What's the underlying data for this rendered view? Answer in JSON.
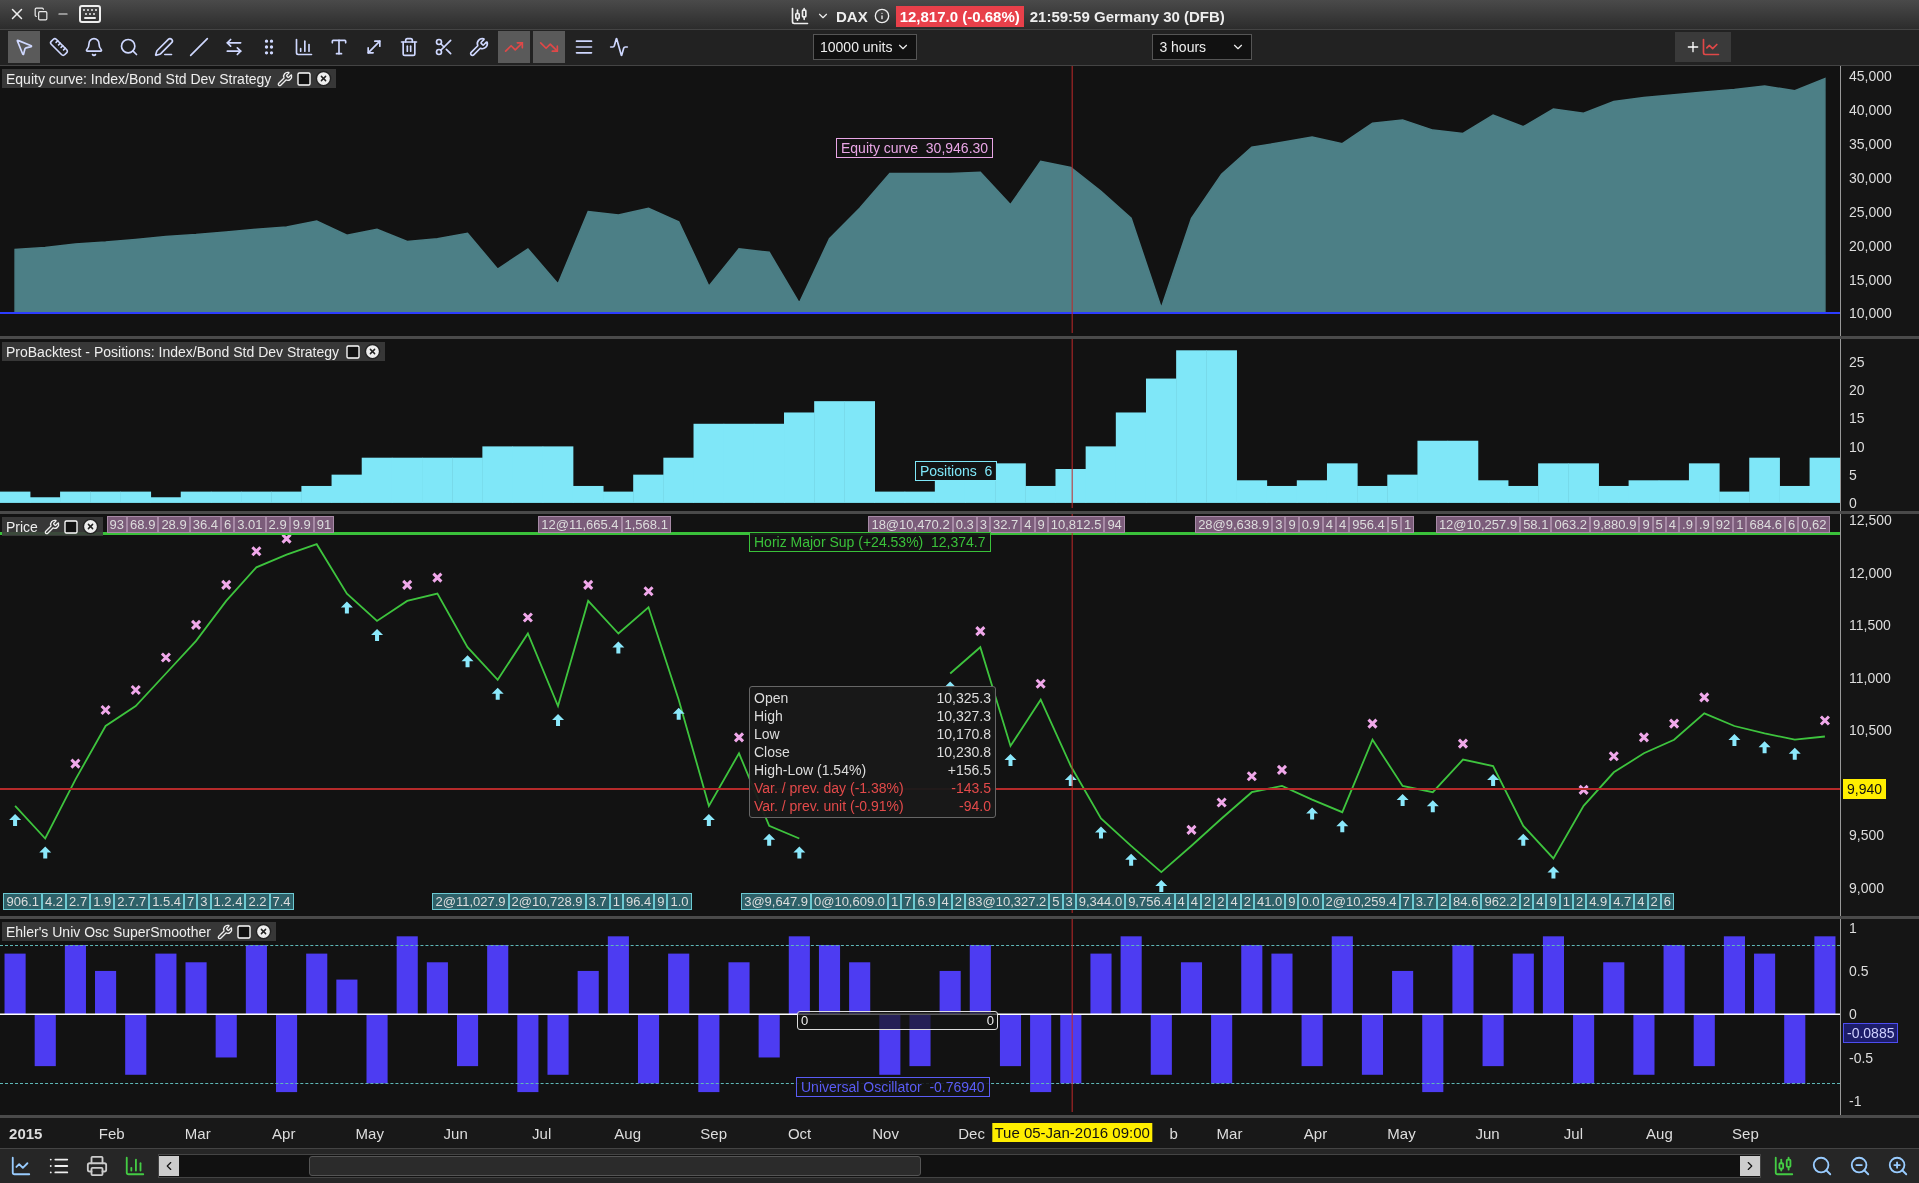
{
  "title_bar": {
    "instrument": "DAX",
    "quote": "12,817.0 (-0.68%)",
    "status": "21:59:59 Germany 30 (DFB)"
  },
  "toolbar": {
    "tools": [
      {
        "selected": true
      },
      {
        "selected": false
      },
      {
        "selected": false
      },
      {
        "selected": false
      },
      {
        "selected": false
      },
      {
        "selected": false
      },
      {
        "selected": false
      },
      {
        "selected": false
      },
      {
        "selected": false
      },
      {
        "selected": false
      },
      {
        "selected": false
      },
      {
        "selected": false
      },
      {
        "selected": false
      },
      {
        "selected": false
      },
      {
        "selected": true
      },
      {
        "selected": true
      },
      {
        "selected": false
      },
      {
        "selected": false
      }
    ],
    "units": "10000 units",
    "timeframe": "3 hours"
  },
  "cursor": {
    "date": "Tue 05-Jan-2016 09:00"
  },
  "equity": {
    "title": "Equity curve: Index/Bond Std Dev Strategy",
    "readout_value": "30,946.30",
    "chart_data": {
      "type": "area",
      "ylim": [
        7100,
        46450
      ],
      "ref_lines": [
        {
          "axis": "y",
          "value": 10000,
          "color": "#2c3cff"
        }
      ],
      "yticks": [
        {
          "value": 45000,
          "label": "45,000"
        },
        {
          "value": 40000,
          "label": "40,000"
        },
        {
          "value": 35000,
          "label": "35,000"
        },
        {
          "value": 30000,
          "label": "30,000"
        },
        {
          "value": 25000,
          "label": "25,000"
        },
        {
          "value": 20000,
          "label": "20,000"
        },
        {
          "value": 15000,
          "label": "15,000"
        },
        {
          "value": 10000,
          "label": "10,000"
        }
      ],
      "series": [
        {
          "name": "Equity curve",
          "color": "#4c7f86",
          "values": [
            19400,
            19700,
            20200,
            20500,
            20900,
            21300,
            21600,
            22000,
            22400,
            22700,
            23600,
            21500,
            22400,
            20600,
            21000,
            21800,
            16500,
            19500,
            14300,
            25000,
            24500,
            25500,
            23500,
            14000,
            19500,
            19000,
            11500,
            21000,
            25500,
            30600,
            30600,
            30600,
            30800,
            26000,
            32400,
            31500,
            28000,
            24000,
            10800,
            24000,
            30500,
            34500,
            35200,
            36000,
            35000,
            38000,
            38500,
            37000,
            36500,
            39200,
            37500,
            40100,
            39500,
            41200,
            41800,
            42200,
            42600,
            43000,
            43500,
            42800,
            44600
          ]
        }
      ]
    }
  },
  "positions": {
    "title": "ProBacktest - Positions: Index/Bond Std Dev Strategy",
    "readout_value": "6",
    "chart_data": {
      "type": "bar",
      "ylim": [
        -0.9,
        29
      ],
      "yticks": [
        {
          "value": 0,
          "label": "0"
        },
        {
          "value": 5,
          "label": "5"
        },
        {
          "value": 10,
          "label": "10"
        },
        {
          "value": 15,
          "label": "15"
        },
        {
          "value": 20,
          "label": "20"
        },
        {
          "value": 25,
          "label": "25"
        }
      ],
      "series": [
        {
          "name": "Positions",
          "color": "#7fe7f8",
          "values": [
            2,
            1,
            2,
            2,
            2,
            1,
            2,
            2,
            2,
            2,
            3,
            5,
            8,
            8,
            8,
            8,
            10,
            10,
            10,
            3,
            2,
            5,
            8,
            14,
            14,
            14,
            16,
            18,
            18,
            2,
            2,
            4,
            4,
            7,
            3,
            6,
            10,
            16,
            22,
            27,
            27,
            4,
            3,
            4,
            7,
            3,
            5,
            11,
            11,
            4,
            3,
            7,
            7,
            3,
            4,
            4,
            7,
            2,
            8,
            3,
            8
          ]
        }
      ]
    }
  },
  "price": {
    "title": "Price",
    "trade_strips": [
      {
        "kind": "entry",
        "groups": [
          {
            "labels": [
              "93",
              "68.9",
              "28.9",
              "36.4",
              "6",
              "3.01",
              "2.9",
              "9.9",
              "91"
            ]
          },
          {
            "labels": [
              "12@11,665.4",
              "1,568.1"
            ]
          },
          {
            "labels": [
              "18@10,470.2",
              "0.3",
              "3",
              "32.7",
              "4",
              "9",
              "10,812.5",
              "94"
            ]
          },
          {
            "labels": [
              "28@9,638.9",
              "3",
              "9",
              "0.9",
              "4",
              "4",
              "956.4",
              "5",
              "1"
            ]
          },
          {
            "labels": [
              "12@10,257.9",
              "58.1",
              "063.2",
              "9,880.9",
              "9",
              "5",
              "4",
              ".9",
              ".9",
              "92",
              "1",
              "684.6",
              "6",
              "0,62"
            ]
          }
        ]
      },
      {
        "kind": "exit",
        "groups": [
          {
            "labels": [
              "906.1",
              "4.2",
              "2.7",
              "1.9",
              "2.7.7",
              "1.5.4",
              "7",
              "3",
              "1.2.4",
              "2.2",
              "7.4"
            ]
          },
          {
            "labels": [
              "2@11,027.9",
              "2@10,728.9",
              "3.7",
              "1",
              "96.4",
              "9",
              "1.0"
            ]
          },
          {
            "labels": [
              "3@9,647.9",
              "0@10,609.0",
              "1",
              "7",
              "6.9",
              "4",
              "2",
              "83@10,327.2",
              "5",
              "3",
              "9,344.0",
              "9,756.4",
              "4",
              "4",
              "2",
              "2",
              "4",
              "2",
              "41.0",
              "9",
              "0.0",
              "2@10,259.4",
              "7",
              "3.7",
              "2",
              "84.6",
              "962.2",
              "2",
              "4",
              "9",
              "1",
              "2",
              "4.9",
              "4.7",
              "4",
              "2",
              "6"
            ]
          }
        ]
      }
    ],
    "support": {
      "name": "Horiz Major Sup (+24.53%)",
      "value": "12,374.7"
    },
    "last_price": "9,940",
    "tooltip": [
      {
        "label": "Open",
        "value": "10,325.3",
        "kind": "normal"
      },
      {
        "label": "High",
        "value": "10,327.3",
        "kind": "normal"
      },
      {
        "label": "Low",
        "value": "10,170.8",
        "kind": "normal"
      },
      {
        "label": "Close",
        "value": "10,230.8",
        "kind": "normal"
      },
      {
        "label": "High-Low (1.54%)",
        "value": "+156.5",
        "kind": "normal"
      },
      {
        "label": "Var. / prev. day (-1.38%)",
        "value": "-143.5",
        "kind": "negative"
      },
      {
        "label": "Var. / prev. unit (-0.91%)",
        "value": "-94.0",
        "kind": "negative"
      }
    ],
    "chart_data": {
      "type": "line",
      "ylim": [
        8761,
        12557
      ],
      "ref_lines": [
        {
          "axis": "y",
          "value": 12374.7,
          "color": "#3ac13a"
        },
        {
          "axis": "y",
          "value": 9940,
          "color": "#b52a2a"
        }
      ],
      "yticks": [
        {
          "value": 12500,
          "label": "12,500"
        },
        {
          "value": 12000,
          "label": "12,000"
        },
        {
          "value": 11500,
          "label": "11,500"
        },
        {
          "value": 11000,
          "label": "11,000"
        },
        {
          "value": 10500,
          "label": "10,500"
        },
        {
          "value": 9500,
          "label": "9,500"
        },
        {
          "value": 9000,
          "label": "9,000"
        }
      ],
      "series": [
        {
          "color": "#3ec43e",
          "values": [
            9780,
            9470,
            10030,
            10540,
            10730,
            11040,
            11350,
            11730,
            12050,
            12170,
            12270,
            11800,
            11540,
            11730,
            11800,
            11290,
            10980,
            11420,
            10730,
            11730,
            11420,
            11670,
            10790,
            9780,
            10280,
            9590,
            9470,
            null,
            null,
            null,
            null,
            11040,
            11290,
            10350,
            10790,
            10160,
            9660,
            9400,
            9150,
            9400,
            9660,
            9910,
            9970,
            9840,
            9720,
            10410,
            9970,
            9910,
            10220,
            10160,
            9590,
            9280,
            9780,
            10100,
            10280,
            10410,
            10660,
            10540,
            10470,
            10410,
            10440
          ]
        }
      ]
    }
  },
  "oscillator": {
    "title": "Ehler's Univ Osc SuperSmoother",
    "readout_value": "-0.76940",
    "zero_box": [
      "0",
      "0"
    ],
    "last": "-0.0885",
    "chart_data": {
      "type": "bar",
      "ylim": [
        -1.13,
        1.1
      ],
      "ref_lines": [
        {
          "axis": "y",
          "value": 0.8,
          "color": "#5fb7b7"
        },
        {
          "axis": "y",
          "value": -0.8,
          "color": "#5fb7b7"
        }
      ],
      "yticks": [
        {
          "value": 1,
          "label": "1"
        },
        {
          "value": 0.5,
          "label": "0.5"
        },
        {
          "value": 0,
          "label": "0"
        },
        {
          "value": -0.5,
          "label": "-0.5"
        },
        {
          "value": -1,
          "label": "-1"
        }
      ],
      "series": [
        {
          "name": "Universal Oscillator",
          "color": "#4d3cf2",
          "values": [
            0.7,
            -0.6,
            0.8,
            0.5,
            -0.7,
            0.7,
            0.6,
            -0.5,
            0.8,
            -0.9,
            0.7,
            0.4,
            -0.8,
            0.9,
            0.6,
            -0.6,
            0.8,
            -0.9,
            -0.7,
            0.5,
            0.9,
            -0.8,
            0.7,
            -0.9,
            0.6,
            -0.5,
            0.9,
            0.8,
            0.6,
            -0.7,
            -0.6,
            0.5,
            0.8,
            -0.6,
            -0.9,
            -0.8,
            0.7,
            0.9,
            -0.7,
            0.6,
            -0.8,
            0.8,
            0.7,
            -0.6,
            0.9,
            -0.7,
            0.5,
            -0.9,
            0.8,
            -0.6,
            0.7,
            0.9,
            -0.8,
            0.6,
            -0.7,
            0.8,
            -0.6,
            0.9,
            0.7,
            -0.8,
            0.9
          ]
        }
      ]
    }
  },
  "time_axis": {
    "ticks": [
      "2015",
      "Feb",
      "Mar",
      "Apr",
      "May",
      "Jun",
      "Jul",
      "Aug",
      "Sep",
      "Oct",
      "Nov",
      "Dec",
      "b",
      "Mar",
      "Apr",
      "May",
      "Jun",
      "Jul",
      "Aug",
      "Sep"
    ]
  }
}
